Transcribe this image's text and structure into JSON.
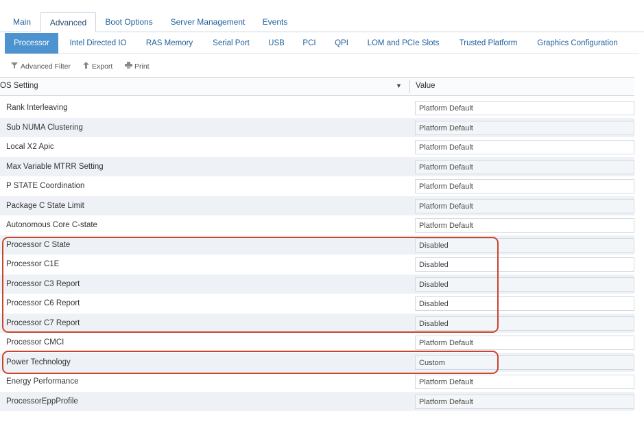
{
  "top_tabs": [
    {
      "label": "Main"
    },
    {
      "label": "Advanced",
      "active": true
    },
    {
      "label": "Boot Options"
    },
    {
      "label": "Server Management"
    },
    {
      "label": "Events"
    }
  ],
  "sub_tabs": [
    {
      "label": "Processor",
      "active": true
    },
    {
      "label": "Intel Directed IO"
    },
    {
      "label": "RAS Memory"
    },
    {
      "label": "Serial Port"
    },
    {
      "label": "USB"
    },
    {
      "label": "PCI"
    },
    {
      "label": "QPI"
    },
    {
      "label": "LOM and PCIe Slots"
    },
    {
      "label": "Trusted Platform"
    },
    {
      "label": "Graphics Configuration"
    }
  ],
  "toolbar": {
    "advanced_filter": "Advanced Filter",
    "export": "Export",
    "print": "Print"
  },
  "grid": {
    "header_setting": "OS Setting",
    "header_value": "Value",
    "rows": [
      {
        "setting": "Rank Interleaving",
        "value": "Platform Default"
      },
      {
        "setting": "Sub NUMA Clustering",
        "value": "Platform Default"
      },
      {
        "setting": "Local X2 Apic",
        "value": "Platform Default"
      },
      {
        "setting": "Max Variable MTRR Setting",
        "value": "Platform Default"
      },
      {
        "setting": "P STATE Coordination",
        "value": "Platform Default"
      },
      {
        "setting": "Package C State Limit",
        "value": "Platform Default"
      },
      {
        "setting": "Autonomous Core C-state",
        "value": "Platform Default"
      },
      {
        "setting": "Processor C State",
        "value": "Disabled"
      },
      {
        "setting": "Processor C1E",
        "value": "Disabled"
      },
      {
        "setting": "Processor C3 Report",
        "value": "Disabled"
      },
      {
        "setting": "Processor C6 Report",
        "value": "Disabled"
      },
      {
        "setting": "Processor C7 Report",
        "value": "Disabled"
      },
      {
        "setting": "Processor CMCI",
        "value": "Platform Default"
      },
      {
        "setting": "Power Technology",
        "value": "Custom"
      },
      {
        "setting": "Energy Performance",
        "value": "Platform Default"
      },
      {
        "setting": "ProcessorEppProfile",
        "value": "Platform Default"
      }
    ]
  },
  "colors": {
    "accent": "#4d93cf",
    "link": "#1d5f9d",
    "highlight": "#c9442d"
  },
  "icons": {
    "advanced_filter": "filter-icon",
    "export": "export-arrow-icon",
    "print": "printer-icon",
    "sort": "caret-down-icon"
  }
}
